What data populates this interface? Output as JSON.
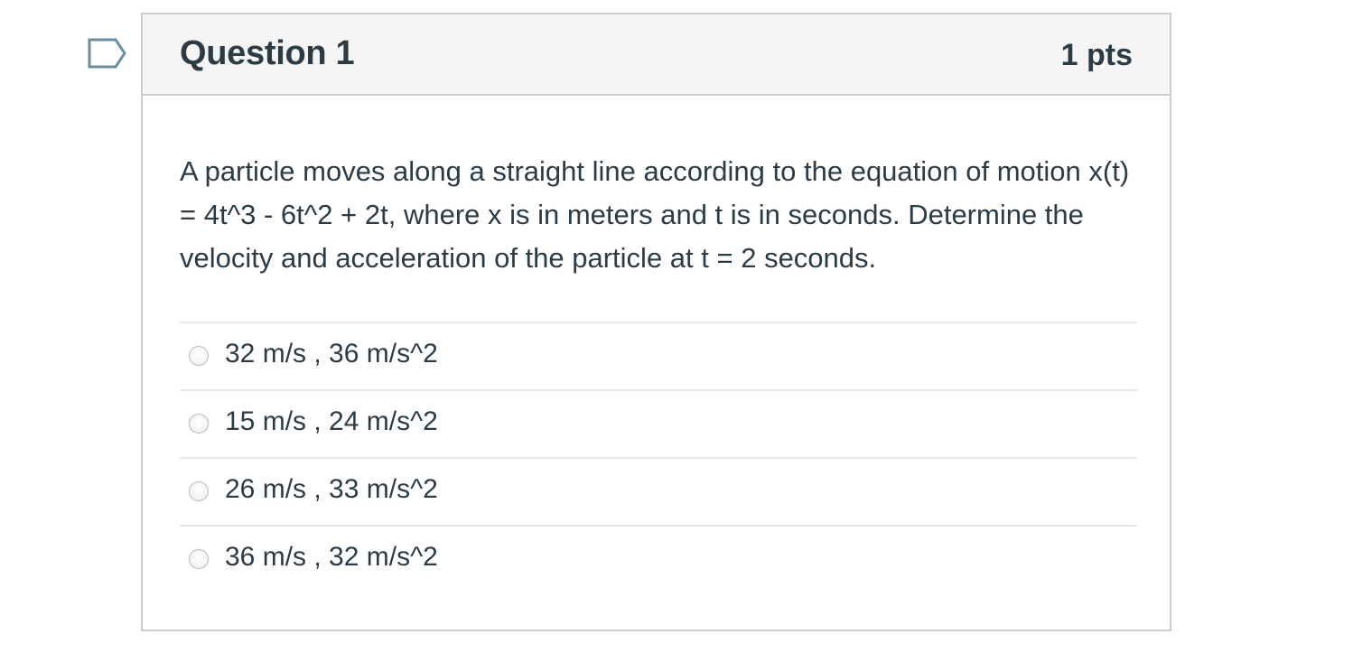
{
  "question": {
    "title": "Question 1",
    "points": "1 pts",
    "text": "A particle moves along a straight line according to the equation of motion x(t) = 4t^3 - 6t^2 + 2t, where x is in meters and t is in seconds. Determine the velocity and acceleration of the particle at t = 2 seconds."
  },
  "answers": [
    {
      "label": "32 m/s , 36 m/s^2",
      "selected": false
    },
    {
      "label": "15 m/s , 24 m/s^2",
      "selected": false
    },
    {
      "label": "26 m/s , 33 m/s^2",
      "selected": false
    },
    {
      "label": "36 m/s , 32 m/s^2",
      "selected": false
    }
  ],
  "colors": {
    "text": "#2d3b45",
    "border": "#c7cdd1",
    "header_bg": "#f5f5f5",
    "flag": "#6b8ea3"
  },
  "icons": {
    "flag": "bookmark-flag-icon",
    "radio": "radio-button-icon"
  }
}
